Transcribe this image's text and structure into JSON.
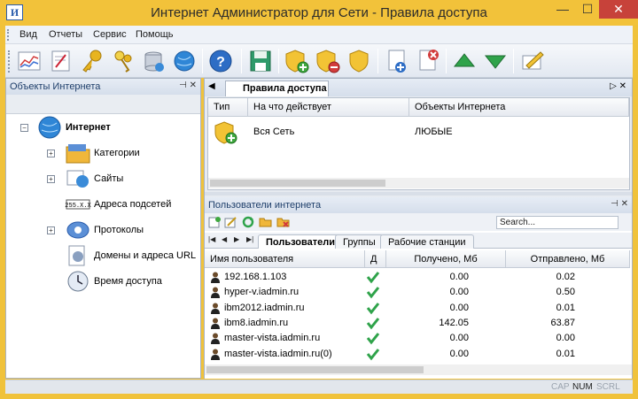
{
  "window": {
    "title": "Интернет Администратор для Сети - Правила доступа",
    "app_icon_text": "И",
    "controls": [
      "—",
      "☐",
      "✕"
    ]
  },
  "menu": [
    "Вид",
    "Отчеты",
    "Сервис",
    "Помощь"
  ],
  "left_panel": {
    "title": "Объекты Интернета",
    "header_icons": "⊣ ✕",
    "tree": {
      "root": "Интернет",
      "children": [
        "Категории",
        "Сайты",
        "Адреса подсетей",
        "Протоколы",
        "Домены и адреса URL",
        "Время доступа"
      ]
    }
  },
  "document": {
    "tab_label": "Правила доступа",
    "tab_nav": "◀",
    "tab_right": "▷ ✕",
    "columns": [
      "Тип",
      "На что действует",
      "Объекты Интернета"
    ],
    "rows": [
      {
        "applies_to": "Вся Сеть",
        "objects": "ЛЮБЫЕ"
      }
    ]
  },
  "users_panel": {
    "title": "Пользователи интернета",
    "header_icons": "⊣ ✕",
    "search_placeholder": "Search...",
    "nav": [
      "|◀",
      "◀",
      "▶",
      "▶|"
    ],
    "tabs": [
      "Пользователи",
      "Группы",
      "Рабочие станции"
    ],
    "columns": [
      "Имя пользователя",
      "Д",
      "Получено, Мб",
      "Отправлено, Мб"
    ],
    "rows": [
      {
        "name": "192.168.1.103",
        "received": "0.00",
        "sent": "0.02"
      },
      {
        "name": "hyper-v.iadmin.ru",
        "received": "0.00",
        "sent": "0.50"
      },
      {
        "name": "ibm2012.iadmin.ru",
        "received": "0.00",
        "sent": "0.01"
      },
      {
        "name": "ibm8.iadmin.ru",
        "received": "142.05",
        "sent": "63.87"
      },
      {
        "name": "master-vista.iadmin.ru",
        "received": "0.00",
        "sent": "0.00"
      },
      {
        "name": "master-vista.iadmin.ru(0)",
        "received": "0.00",
        "sent": "0.01"
      }
    ]
  },
  "status": {
    "cap": "CAP",
    "num": "NUM",
    "scrl": "SCRL"
  }
}
